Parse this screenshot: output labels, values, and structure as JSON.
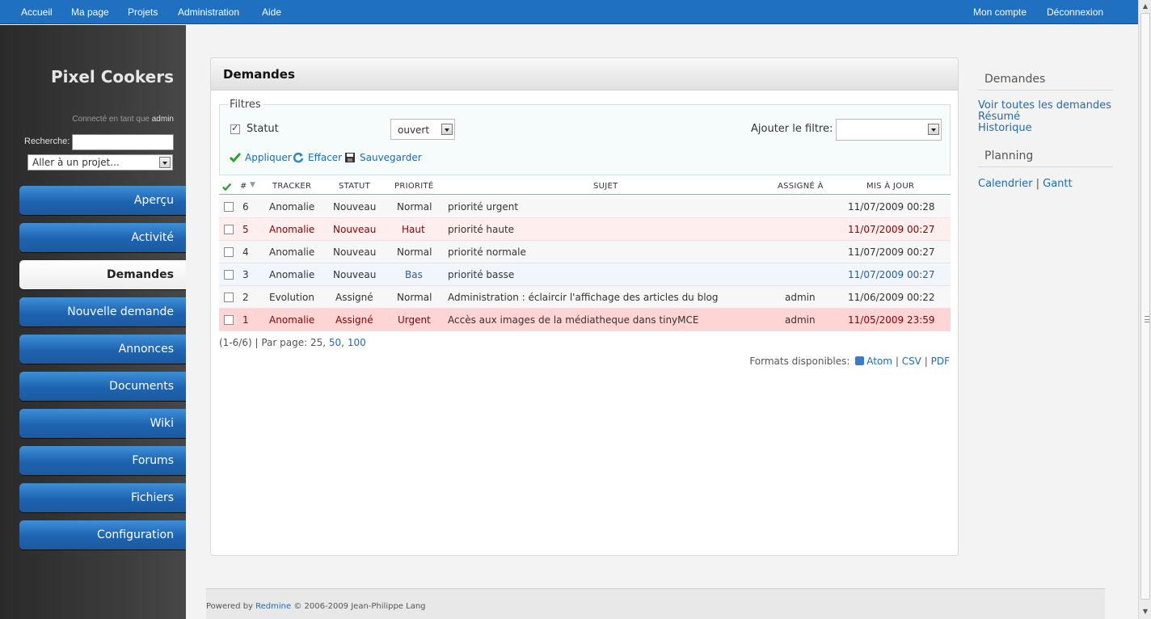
{
  "top_menu": {
    "left": [
      "Accueil",
      "Ma page",
      "Projets",
      "Administration",
      "Aide"
    ],
    "right": [
      "Mon compte",
      "Déconnexion"
    ]
  },
  "sidebar": {
    "site_title": "Pixel Cookers",
    "logged_in_prefix": "Connecté en tant que",
    "logged_in_user": "admin",
    "search_label": "Recherche:",
    "search_value": "",
    "project_jump": "Aller à un projet...",
    "menu": [
      "Aperçu",
      "Activité",
      "Demandes",
      "Nouvelle demande",
      "Annonces",
      "Documents",
      "Wiki",
      "Forums",
      "Fichiers",
      "Configuration"
    ],
    "selected_menu": "Demandes"
  },
  "content": {
    "title": "Demandes",
    "filters": {
      "legend": "Filtres",
      "statut_label": "Statut",
      "statut_checked": true,
      "statut_value": "ouvert",
      "add_filter_label": "Ajouter le filtre:",
      "add_filter_value": "",
      "actions": [
        "Appliquer",
        "Effacer",
        "Sauvegarder"
      ]
    },
    "table": {
      "headers": [
        "#",
        "TRACKER",
        "STATUT",
        "PRIORITÉ",
        "SUJET",
        "ASSIGNÉ À",
        "MIS À JOUR"
      ],
      "rows": [
        {
          "id": "6",
          "tracker": "Anomalie",
          "statut": "Nouveau",
          "priorite": "Normal",
          "sujet": "priorité urgent",
          "assigne": "",
          "maj": "11/07/2009 00:28",
          "style": "odd"
        },
        {
          "id": "5",
          "tracker": "Anomalie",
          "statut": "Nouveau",
          "priorite": "Haut",
          "sujet": "priorité haute",
          "assigne": "",
          "maj": "11/07/2009 00:27",
          "style": "high"
        },
        {
          "id": "4",
          "tracker": "Anomalie",
          "statut": "Nouveau",
          "priorite": "Normal",
          "sujet": "priorité normale",
          "assigne": "",
          "maj": "11/07/2009 00:27",
          "style": "odd"
        },
        {
          "id": "3",
          "tracker": "Anomalie",
          "statut": "Nouveau",
          "priorite": "Bas",
          "sujet": "priorité basse",
          "assigne": "",
          "maj": "11/07/2009 00:27",
          "style": "low"
        },
        {
          "id": "2",
          "tracker": "Evolution",
          "statut": "Assigné",
          "priorite": "Normal",
          "sujet": "Administration : éclaircir l'affichage des articles du blog",
          "assigne": "admin",
          "maj": "11/06/2009 00:22",
          "style": "odd"
        },
        {
          "id": "1",
          "tracker": "Anomalie",
          "statut": "Assigné",
          "priorite": "Urgent",
          "sujet": "Accès aux images de la médiatheque dans tinyMCE",
          "assigne": "admin",
          "maj": "11/05/2009 23:59",
          "style": "urgent"
        }
      ]
    },
    "pagination": {
      "range": "(1-6/6)",
      "per_page_label": "| Par page:",
      "options": [
        "25",
        "50",
        "100"
      ],
      "current": "25"
    },
    "formats": {
      "label": "Formats disponibles:",
      "items": [
        "Atom",
        "CSV",
        "PDF"
      ]
    }
  },
  "right_sidebar": {
    "demandes_heading": "Demandes",
    "demandes_links": [
      "Voir toutes les demandes",
      "Résumé",
      "Historique"
    ],
    "planning_heading": "Planning",
    "planning_links": [
      "Calendrier",
      "Gantt"
    ]
  },
  "footer": {
    "prefix": "Powered by",
    "link": "Redmine",
    "suffix": "© 2006-2009 Jean-Philippe Lang"
  },
  "colors": {
    "top_menu_bg": "#1f70c0",
    "link": "#1f6bb0",
    "high_priority_text": "#8a0000"
  }
}
